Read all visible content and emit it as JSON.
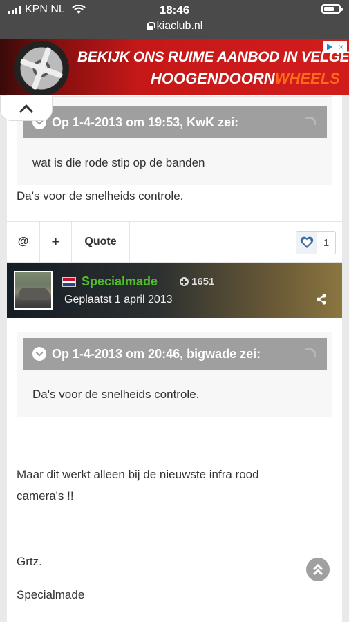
{
  "status_bar": {
    "carrier": "KPN NL",
    "time": "18:46",
    "url": "kiaclub.nl"
  },
  "ad": {
    "line1": "BEKIJK ONS RUIME AANBOD IN VELGEN",
    "brand_part1": "HOOGENDOORN",
    "brand_part2": "WHEELS",
    "close_label": "×"
  },
  "post1": {
    "quote_header": "Op 1-4-2013 om 19:53, KwK zei:",
    "quote_text": "wat is die rode stip op de banden",
    "body": "Da's voor de snelheids controle."
  },
  "actions": {
    "mention": "@",
    "add": "+",
    "quote": "Quote",
    "like_count": "1"
  },
  "author": {
    "name": "Specialmade",
    "reputation": "1651",
    "posted": "Geplaatst 1 april 2013",
    "name_color": "#4fbf2a"
  },
  "post2": {
    "quote_header": "Op 1-4-2013 om 20:46, bigwade zei:",
    "quote_text": "Da's voor de snelheids controle.",
    "body_line1": "Maar dit werkt alleen bij de nieuwste infra rood",
    "body_line2": "camera's !!",
    "greeting": "Grtz.",
    "signature": "Specialmade"
  },
  "icons": {
    "collapse": "chevron-up-icon",
    "scroll_top": "double-chevron-up-icon",
    "share": "share-icon",
    "like": "heart-icon"
  }
}
